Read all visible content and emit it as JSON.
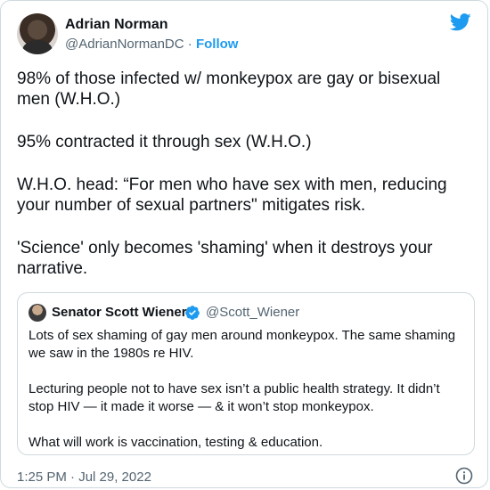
{
  "author": {
    "name": "Adrian Norman",
    "handle": "@AdrianNormanDC",
    "separator": " · ",
    "follow_label": "Follow"
  },
  "tweet": {
    "paragraphs": [
      "98% of those infected w/ monkeypox are gay or bisexual men (W.H.O.)",
      "95% contracted it through sex (W.H.O.)",
      "W.H.O. head: “For men who have sex with men, reducing your number of sexual partners\" mitigates risk.",
      "'Science' only becomes 'shaming' when it destroys your narrative."
    ]
  },
  "quoted": {
    "name": "Senator Scott Wiener",
    "handle": "@Scott_Wiener",
    "paragraphs": [
      "Lots of sex shaming of gay men around monkeypox. The same shaming we saw in the 1980s re HIV.",
      "Lecturing people not to have sex isn’t a public health strategy. It didn’t stop HIV — it made it worse — & it won’t stop monkeypox.",
      "What will work is vaccination, testing & education."
    ]
  },
  "meta": {
    "timestamp": "1:25 PM · Jul 29, 2022"
  },
  "icons": {
    "brand": "twitter-bird-icon",
    "verified": "verified-badge-icon",
    "info": "info-icon"
  },
  "colors": {
    "accent": "#1d9bf0",
    "text": "#0f1419",
    "secondary": "#536471",
    "border": "#cfd9de"
  }
}
